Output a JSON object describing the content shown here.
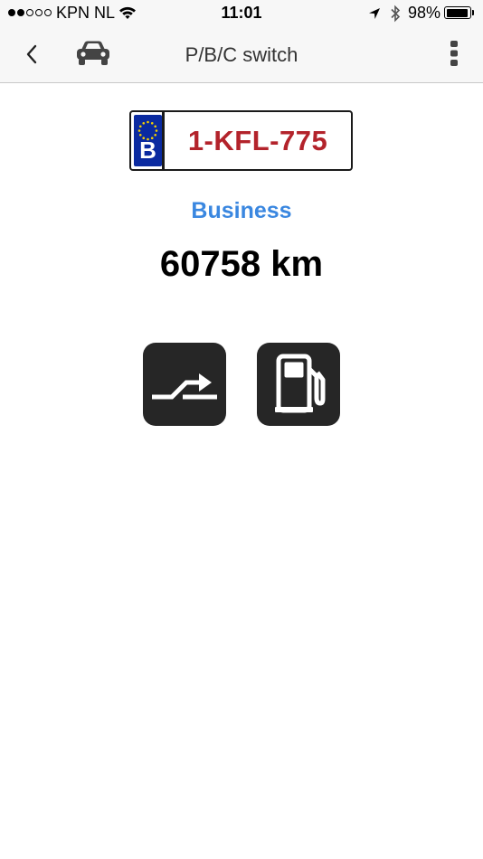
{
  "status_bar": {
    "signal_bars": 5,
    "signal_filled": 2,
    "carrier": "KPN NL",
    "wifi_icon": "wifi-icon",
    "time": "11:01",
    "location_icon": "location-arrow-icon",
    "bluetooth_icon": "bluetooth-icon",
    "battery_percent": "98%",
    "battery_level": 0.98
  },
  "nav": {
    "back_icon": "chevron-left-icon",
    "car_icon": "car-icon",
    "title": "P/B/C switch",
    "more_icon": "vertical-dots-icon"
  },
  "plate": {
    "country": "B",
    "number": "1-KFL-775",
    "colors": {
      "band": "#0a2aa0",
      "text": "#b3232b",
      "stars": "#f5d000"
    }
  },
  "vehicle": {
    "mode": "Business",
    "mode_color": "#3a87e0",
    "odometer": "60758 km"
  },
  "actions": [
    {
      "icon": "switch-arrow-icon"
    },
    {
      "icon": "fuel-pump-icon"
    }
  ]
}
